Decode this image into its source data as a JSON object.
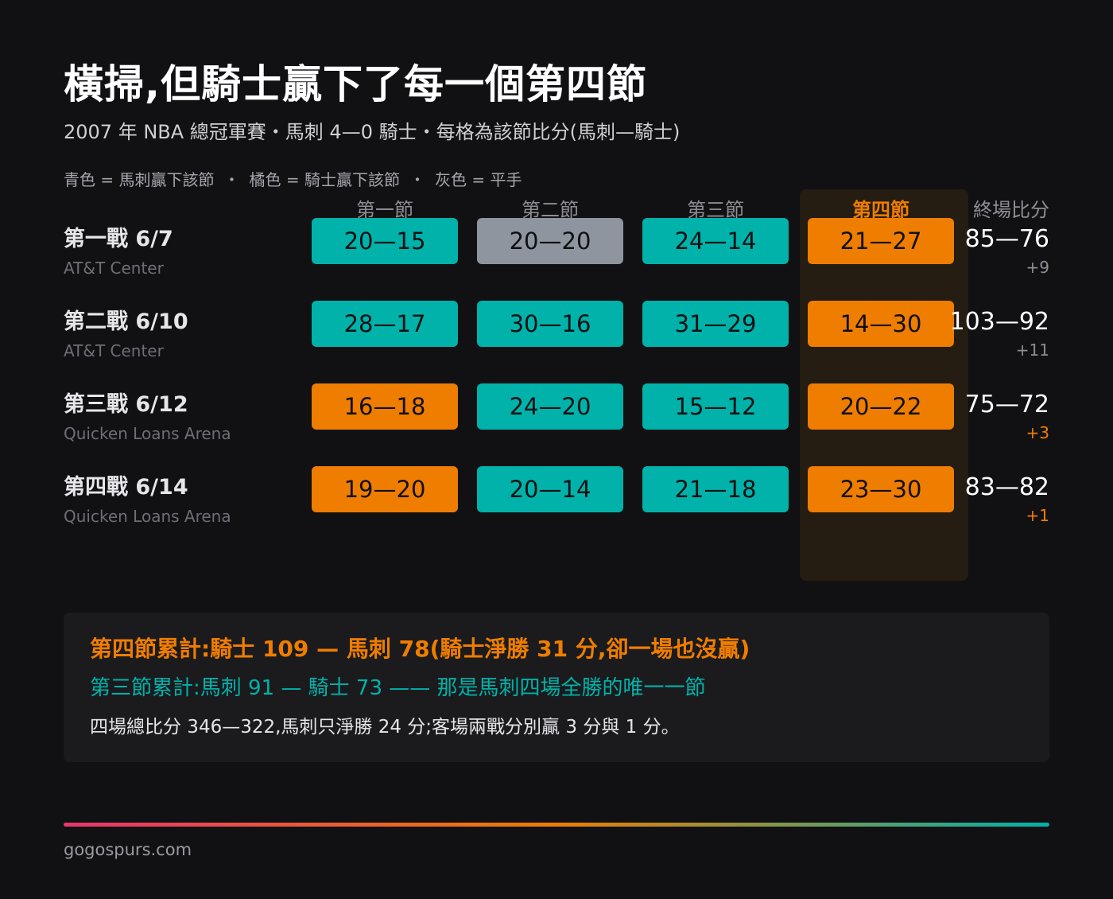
{
  "title": "橫掃,但騎士贏下了每一個第四節",
  "subtitle": "2007 年 NBA 總冠軍賽・馬刺 4—0 騎士・每格為該節比分(馬刺—騎士)",
  "legend": {
    "teal": "青色 = 馬刺贏下該節",
    "orange": "橘色 = 騎士贏下該節",
    "gray": "灰色 = 平手",
    "separator": "・"
  },
  "colors": {
    "teal": "#00b2a9",
    "orange": "#ef7d00",
    "gray": "#8e959e",
    "background": "#111114",
    "panel": "#1b1b1e"
  },
  "chart_data": {
    "type": "table",
    "columns": [
      "第一節",
      "第二節",
      "第三節",
      "第四節",
      "終場比分"
    ],
    "highlight_column": "第四節",
    "rows": [
      {
        "game": "第一戰 6/7",
        "venue": "AT&T Center",
        "quarters": [
          {
            "label": "20—15",
            "spurs": 20,
            "cavs": 15,
            "winner": "teal"
          },
          {
            "label": "20—20",
            "spurs": 20,
            "cavs": 20,
            "winner": "gray"
          },
          {
            "label": "24—14",
            "spurs": 24,
            "cavs": 14,
            "winner": "teal"
          },
          {
            "label": "21—27",
            "spurs": 21,
            "cavs": 27,
            "winner": "orange"
          }
        ],
        "final": "85—76",
        "margin": "+9",
        "margin_color": "#8d8d94"
      },
      {
        "game": "第二戰 6/10",
        "venue": "AT&T Center",
        "quarters": [
          {
            "label": "28—17",
            "spurs": 28,
            "cavs": 17,
            "winner": "teal"
          },
          {
            "label": "30—16",
            "spurs": 30,
            "cavs": 16,
            "winner": "teal"
          },
          {
            "label": "31—29",
            "spurs": 31,
            "cavs": 29,
            "winner": "teal"
          },
          {
            "label": "14—30",
            "spurs": 14,
            "cavs": 30,
            "winner": "orange"
          }
        ],
        "final": "103—92",
        "margin": "+11",
        "margin_color": "#8d8d94"
      },
      {
        "game": "第三戰 6/12",
        "venue": "Quicken Loans Arena",
        "quarters": [
          {
            "label": "16—18",
            "spurs": 16,
            "cavs": 18,
            "winner": "orange"
          },
          {
            "label": "24—20",
            "spurs": 24,
            "cavs": 20,
            "winner": "teal"
          },
          {
            "label": "15—12",
            "spurs": 15,
            "cavs": 12,
            "winner": "teal"
          },
          {
            "label": "20—22",
            "spurs": 20,
            "cavs": 22,
            "winner": "orange"
          }
        ],
        "final": "75—72",
        "margin": "+3",
        "margin_color": "#ef7d00"
      },
      {
        "game": "第四戰 6/14",
        "venue": "Quicken Loans Arena",
        "quarters": [
          {
            "label": "19—20",
            "spurs": 19,
            "cavs": 20,
            "winner": "orange"
          },
          {
            "label": "20—14",
            "spurs": 20,
            "cavs": 14,
            "winner": "teal"
          },
          {
            "label": "21—18",
            "spurs": 21,
            "cavs": 18,
            "winner": "teal"
          },
          {
            "label": "23—30",
            "spurs": 23,
            "cavs": 30,
            "winner": "orange"
          }
        ],
        "final": "83—82",
        "margin": "+1",
        "margin_color": "#ef7d00"
      }
    ]
  },
  "summary": {
    "line1": "第四節累計:騎士 109 — 馬刺 78(騎士淨勝 31 分,卻一場也沒贏)",
    "line2": "第三節累計:馬刺 91 — 騎士 73 —— 那是馬刺四場全勝的唯一一節",
    "line3": "四場總比分 346—322,馬刺只淨勝 24 分;客場兩戰分別贏 3 分與 1 分。"
  },
  "footer": "gogospurs.com"
}
